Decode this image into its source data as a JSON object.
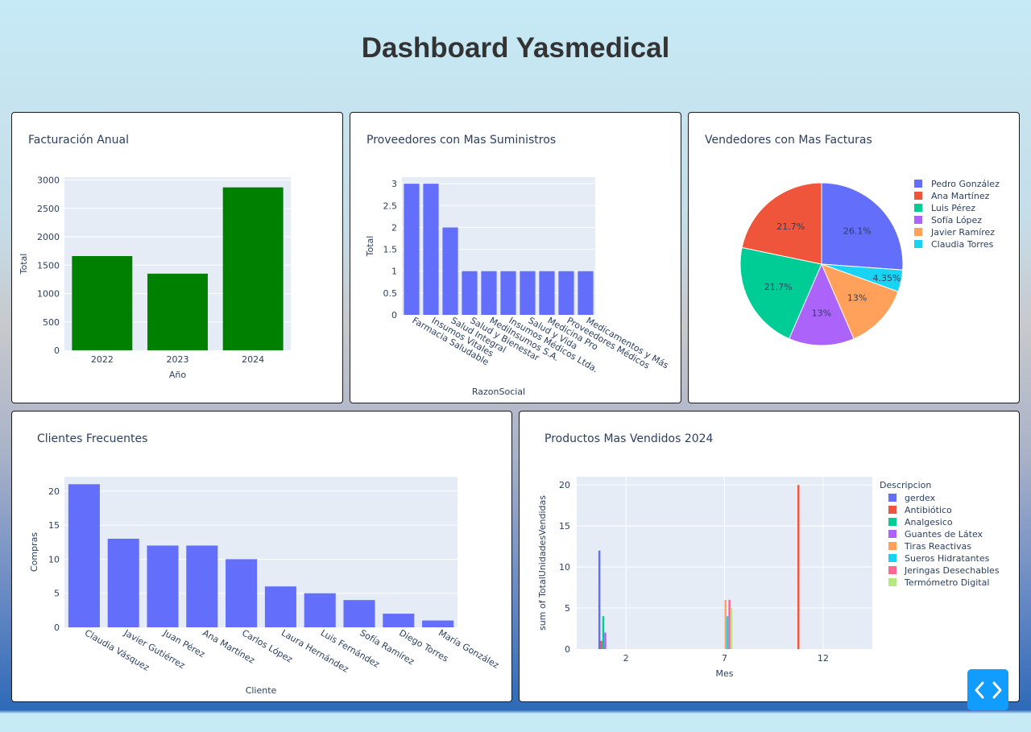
{
  "page": {
    "title": "Dashboard Yasmedical"
  },
  "colors": {
    "bar_green": "#008000",
    "bar_blue": "#636efa",
    "plot_bg": "#e5ecf6",
    "text": "#2a3f5f",
    "code_button": "#119dff"
  },
  "code_button": {
    "icon": "code-icon"
  },
  "charts": {
    "facturacion": {
      "title": "Facturación Anual"
    },
    "proveedores": {
      "title": "Proveedores con Mas Suministros"
    },
    "vendedores": {
      "title": "Vendedores con Mas Facturas"
    },
    "clientes": {
      "title": "Clientes Frecuentes"
    },
    "productos": {
      "title": "Productos Mas Vendidos 2024"
    }
  },
  "chart_data": [
    {
      "id": "facturacion",
      "type": "bar",
      "title": "Facturación Anual",
      "xlabel": "Año",
      "ylabel": "Total",
      "categories": [
        "2022",
        "2023",
        "2024"
      ],
      "values": [
        1660,
        1350,
        2870
      ],
      "ylim": [
        0,
        3050
      ],
      "yticks": [
        0,
        500,
        1000,
        1500,
        2000,
        2500,
        3000
      ],
      "color": "#008000"
    },
    {
      "id": "proveedores",
      "type": "bar",
      "title": "Proveedores con Mas Suministros",
      "xlabel": "RazonSocial",
      "ylabel": "Total",
      "categories": [
        "Farmacia Saludable",
        "Insumos Vitales",
        "Salud Integral",
        "Salud y Bienestar",
        "MediInsumos S.A.",
        "Insumos Médicos Ltda.",
        "Salud y Vida",
        "Medicina Pro",
        "Proveedores Médicos",
        "Medicamentos y Más"
      ],
      "values": [
        3,
        3,
        2,
        1,
        1,
        1,
        1,
        1,
        1,
        1
      ],
      "ylim": [
        0,
        3.15
      ],
      "yticks": [
        "0",
        "0.5",
        "1",
        "1.5",
        "2",
        "2.5",
        "3"
      ],
      "color": "#636efa"
    },
    {
      "id": "vendedores",
      "type": "pie",
      "title": "Vendedores con Mas Facturas",
      "labels": [
        "Pedro González",
        "Claudia Torres",
        "Javier Ramírez",
        "Sofía López",
        "Luis Pérez",
        "Ana Martínez"
      ],
      "values": [
        26.1,
        4.35,
        13,
        13,
        21.7,
        21.7
      ],
      "text": [
        "26.1%",
        "4.35%",
        "13%",
        "13%",
        "21.7%",
        "21.7%"
      ],
      "colors": [
        "#636efa",
        "#19d3f3",
        "#ffa15a",
        "#ab63fa",
        "#00cc96",
        "#ef553b"
      ],
      "legend": [
        "Pedro González",
        "Ana Martínez",
        "Luis Pérez",
        "Sofía López",
        "Javier Ramírez",
        "Claudia Torres"
      ],
      "legend_colors": [
        "#636efa",
        "#ef553b",
        "#00cc96",
        "#ab63fa",
        "#ffa15a",
        "#19d3f3"
      ],
      "legend_position": "right"
    },
    {
      "id": "clientes",
      "type": "bar",
      "title": "Clientes Frecuentes",
      "xlabel": "Cliente",
      "ylabel": "Compras",
      "categories": [
        "Claudia Vásquez",
        "Javier Gutiérrez",
        "Juan Pérez",
        "Ana Martínez",
        "Carlos López",
        "Laura Hernández",
        "Luis Fernández",
        "Sofía Ramírez",
        "Diego Torres",
        "María González"
      ],
      "values": [
        21,
        13,
        12,
        12,
        10,
        6,
        5,
        4,
        2,
        1
      ],
      "ylim": [
        0,
        22.1
      ],
      "yticks": [
        "0",
        "5",
        "10",
        "15",
        "20"
      ],
      "color": "#636efa"
    },
    {
      "id": "productos",
      "type": "bar",
      "title": "Productos Mas Vendidos 2024",
      "xlabel": "Mes",
      "ylabel": "sum of TotalUnidadesVendidas",
      "legend_title": "Descripcion",
      "xlim": [
        -0.5,
        14.5
      ],
      "xticks": [
        2,
        7,
        12
      ],
      "ylim": [
        0,
        21
      ],
      "yticks": [
        "0",
        "5",
        "10",
        "15",
        "20"
      ],
      "slots": 8,
      "series": [
        {
          "name": "gerdex",
          "color": "#636efa",
          "points": [
            {
              "x": 1,
              "y": 12
            }
          ]
        },
        {
          "name": "Antibiótico",
          "color": "#ef553b",
          "points": [
            {
              "x": 1,
              "y": 1
            },
            {
              "x": 11,
              "y": 20
            }
          ]
        },
        {
          "name": "Analgesico",
          "color": "#00cc96",
          "points": [
            {
              "x": 1,
              "y": 4
            }
          ]
        },
        {
          "name": "Guantes de Látex",
          "color": "#ab63fa",
          "points": [
            {
              "x": 1,
              "y": 2
            }
          ]
        },
        {
          "name": "Tiras Reactivas",
          "color": "#ffa15a",
          "points": [
            {
              "x": 7,
              "y": 6
            }
          ]
        },
        {
          "name": "Sueros Hidratantes",
          "color": "#19d3f3",
          "points": [
            {
              "x": 7,
              "y": 4
            }
          ]
        },
        {
          "name": "Jeringas Desechables",
          "color": "#ff6692",
          "points": [
            {
              "x": 7,
              "y": 6
            }
          ]
        },
        {
          "name": "Termómetro Digital",
          "color": "#b6e880",
          "points": [
            {
              "x": 7,
              "y": 5
            }
          ]
        }
      ]
    }
  ]
}
